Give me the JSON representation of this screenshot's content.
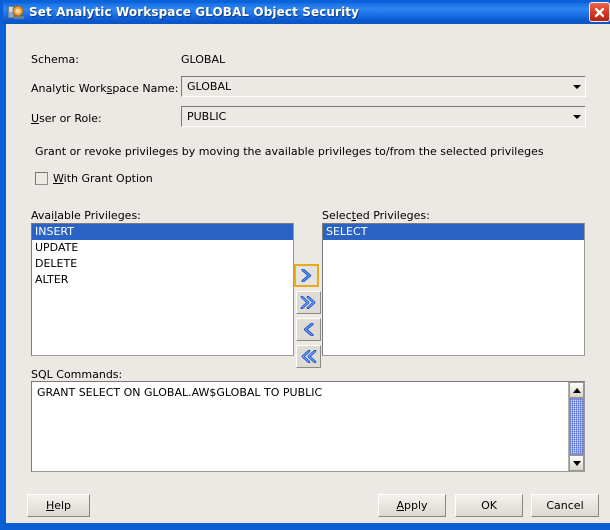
{
  "window": {
    "title": "Set Analytic Workspace GLOBAL Object Security",
    "icon": "workspace-security-icon",
    "close_label": "×",
    "titlebar_color": "#0a62d8",
    "close_button_color": "#d9402a",
    "client_background": "#ece9e4"
  },
  "form": {
    "schema_label": "Schema:",
    "schema_value": "GLOBAL",
    "aw_name_label_pre": "Analytic Workspace Name:",
    "aw_name_label_a": "Analytic Work",
    "aw_name_label_mn": "s",
    "aw_name_label_b": "pace Name:",
    "aw_name_value": "GLOBAL",
    "user_role_label_mn": "U",
    "user_role_label_rest": "ser or Role:",
    "user_role_value": "PUBLIC",
    "dropdown_icon": "chevron-down-icon"
  },
  "instructions": {
    "text": "Grant or revoke privileges by moving the available privileges to/from the selected privileges"
  },
  "grant_option": {
    "label_mn": "W",
    "label_rest": "ith Grant Option",
    "checked": false
  },
  "available": {
    "label_a": "Avai",
    "label_mn": "l",
    "label_b": "able Privileges:",
    "items": [
      {
        "label": "INSERT",
        "selected": true
      },
      {
        "label": "UPDATE",
        "selected": false
      },
      {
        "label": "DELETE",
        "selected": false
      },
      {
        "label": "ALTER",
        "selected": false
      }
    ]
  },
  "selected": {
    "label_a": "Selec",
    "label_mn": "t",
    "label_b": "ed Privileges:",
    "items": [
      {
        "label": "SELECT",
        "selected": true
      }
    ]
  },
  "transfer_buttons": [
    {
      "name": "move-right-button",
      "icon": "chevron-right-icon",
      "focused": true
    },
    {
      "name": "move-all-right-button",
      "icon": "double-chevron-right-icon",
      "focused": false
    },
    {
      "name": "move-left-button",
      "icon": "chevron-left-icon",
      "focused": false
    },
    {
      "name": "move-all-left-button",
      "icon": "double-chevron-left-icon",
      "focused": false
    }
  ],
  "sql": {
    "label": "SQL Commands:",
    "text": "GRANT SELECT ON GLOBAL.AW$GLOBAL TO PUBLIC",
    "scroll_up_icon": "triangle-up-icon",
    "scroll_down_icon": "triangle-down-icon"
  },
  "buttons": {
    "help_mn": "H",
    "help_rest": "elp",
    "apply_mn": "A",
    "apply_rest": "pply",
    "ok": "OK",
    "cancel": "Cancel"
  }
}
